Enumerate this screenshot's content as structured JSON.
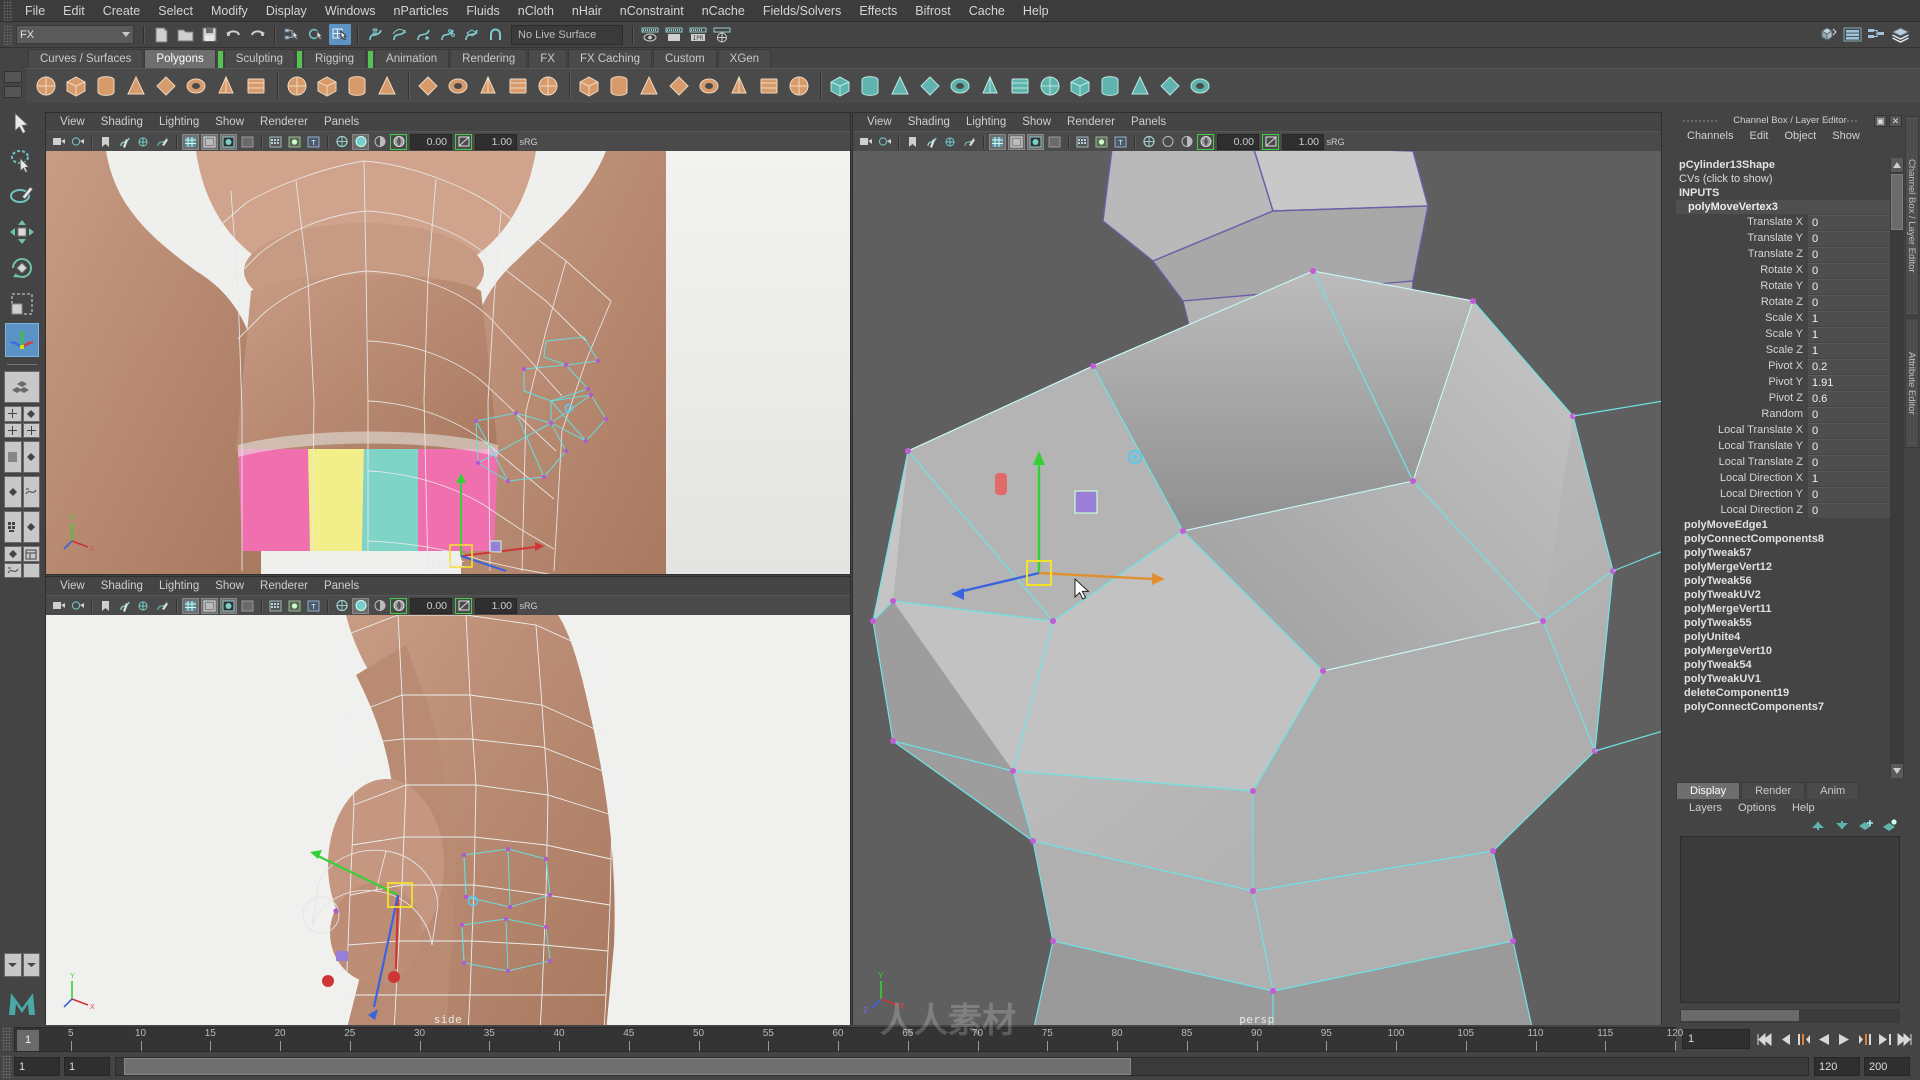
{
  "app": {
    "title": "Autodesk Maya"
  },
  "menubar": {
    "items": [
      "File",
      "Edit",
      "Create",
      "Select",
      "Modify",
      "Display",
      "Windows",
      "nParticles",
      "Fluids",
      "nCloth",
      "nHair",
      "nConstraint",
      "nCache",
      "Fields/Solvers",
      "Effects",
      "Bifrost",
      "Cache",
      "Help"
    ]
  },
  "statusline": {
    "menuset": "FX",
    "live_surface": "No Live Surface",
    "numeric_a": "0.00",
    "numeric_b": "1.00",
    "colorspace": "sRG",
    "icons": [
      "new-scene-icon",
      "open-scene-icon",
      "save-scene-icon",
      "undo-icon",
      "redo-icon",
      "select-by-hierarchy-icon",
      "select-by-object-icon",
      "select-by-component-icon",
      "snap-to-grid-icon",
      "snap-to-curve-icon",
      "snap-to-point-icon",
      "snap-to-projected-center-icon",
      "snap-to-view-plane-icon",
      "make-live-icon",
      "render-current-frame-icon",
      "ipr-render-icon",
      "render-settings-icon",
      "open-hypershade-icon",
      "open-outliner-icon",
      "open-node-editor-icon",
      "toggle-layers-icon"
    ]
  },
  "shelf": {
    "tabs": [
      {
        "label": "Curves / Surfaces",
        "active": false
      },
      {
        "label": "Polygons",
        "active": true
      },
      {
        "label": "Sculpting",
        "active": false
      },
      {
        "label": "Rigging",
        "active": false
      },
      {
        "label": "Animation",
        "active": false
      },
      {
        "label": "Rendering",
        "active": false
      },
      {
        "label": "FX",
        "active": false
      },
      {
        "label": "FX Caching",
        "active": false
      },
      {
        "label": "Custom",
        "active": false
      },
      {
        "label": "XGen",
        "active": false
      }
    ],
    "buttons": [
      "poly-sphere-icon",
      "poly-cube-icon",
      "poly-cylinder-icon",
      "poly-cone-icon",
      "poly-torus-icon",
      "poly-plane-icon",
      "poly-pyramid-icon",
      "poly-prism-icon",
      "poly-pipe-icon",
      "poly-helix-icon",
      "poly-soccer-ball-icon",
      "poly-platonic-icon",
      "combine-icon",
      "separate-icon",
      "booleans-icon",
      "smooth-icon",
      "mirror-icon",
      "reduce-icon",
      "multicut-icon",
      "extrude-icon",
      "bevel-icon",
      "bridge-icon",
      "append-polygon-icon",
      "wedge-icon",
      "target-weld-icon",
      "quad-draw-icon",
      "connect-icon",
      "crease-icon",
      "insert-edge-loop-icon",
      "offset-edge-loop-icon",
      "slide-edge-icon",
      "sculpt-icon",
      "uv-editor-icon",
      "uv-planar-icon",
      "uv-cylindrical-icon",
      "uv-automatic-icon",
      "uv-unfold-icon",
      "uv-layout-icon"
    ]
  },
  "toolbox": {
    "tools": [
      {
        "name": "select-tool",
        "selected": false
      },
      {
        "name": "lasso-select-tool",
        "selected": false
      },
      {
        "name": "paint-select-tool",
        "selected": false
      },
      {
        "name": "move-tool",
        "selected": false
      },
      {
        "name": "rotate-tool",
        "selected": false
      },
      {
        "name": "scale-tool",
        "selected": false
      },
      {
        "name": "last-tool-used",
        "selected": true
      }
    ],
    "layouts": [
      "single-perspective-layout",
      "four-view-layout",
      "two-panes-side-layout",
      "outliner-persp-layout",
      "persp-graph-layout",
      "hypershade-persp-layout",
      "outliner-persp-graph-layout"
    ]
  },
  "viewports": [
    {
      "id": "front",
      "label": "front",
      "menus": [
        "View",
        "Shading",
        "Lighting",
        "Show",
        "Renderer",
        "Panels"
      ],
      "numeric_a": "0.00",
      "numeric_b": "1.00",
      "colorspace": "sRG"
    },
    {
      "id": "side",
      "label": "side",
      "menus": [
        "View",
        "Shading",
        "Lighting",
        "Show",
        "Renderer",
        "Panels"
      ],
      "numeric_a": "0.00",
      "numeric_b": "1.00",
      "colorspace": "sRG"
    },
    {
      "id": "persp",
      "label": "persp",
      "menus": [
        "View",
        "Shading",
        "Lighting",
        "Show",
        "Renderer",
        "Panels"
      ],
      "numeric_a": "0.00",
      "numeric_b": "1.00",
      "colorspace": "sRG"
    }
  ],
  "channel_box": {
    "panel_title": "Channel Box / Layer Editor",
    "menus": [
      "Channels",
      "Edit",
      "Object",
      "Show"
    ],
    "shape_name": "pCylinder13Shape",
    "cvs_row": "CVs (click to show)",
    "inputs_header": "INPUTS",
    "input_node": "polyMoveVertex3",
    "attributes": [
      {
        "label": "Translate X",
        "value": "0"
      },
      {
        "label": "Translate Y",
        "value": "0"
      },
      {
        "label": "Translate Z",
        "value": "0"
      },
      {
        "label": "Rotate X",
        "value": "0"
      },
      {
        "label": "Rotate Y",
        "value": "0"
      },
      {
        "label": "Rotate Z",
        "value": "0"
      },
      {
        "label": "Scale X",
        "value": "1"
      },
      {
        "label": "Scale Y",
        "value": "1"
      },
      {
        "label": "Scale Z",
        "value": "1"
      },
      {
        "label": "Pivot X",
        "value": "0.2"
      },
      {
        "label": "Pivot Y",
        "value": "1.91"
      },
      {
        "label": "Pivot Z",
        "value": "0.6"
      },
      {
        "label": "Random",
        "value": "0"
      },
      {
        "label": "Local Translate X",
        "value": "0"
      },
      {
        "label": "Local Translate Y",
        "value": "0"
      },
      {
        "label": "Local Translate Z",
        "value": "0"
      },
      {
        "label": "Local Direction X",
        "value": "1"
      },
      {
        "label": "Local Direction Y",
        "value": "0"
      },
      {
        "label": "Local Direction Z",
        "value": "0"
      }
    ],
    "history_nodes": [
      "polyMoveEdge1",
      "polyConnectComponents8",
      "polyTweak57",
      "polyMergeVert12",
      "polyTweak56",
      "polyTweakUV2",
      "polyMergeVert11",
      "polyTweak55",
      "polyUnite4",
      "polyMergeVert10",
      "polyTweak54",
      "polyTweakUV1",
      "deleteComponent19",
      "polyConnectComponents7"
    ]
  },
  "layer_editor": {
    "tabs": [
      {
        "label": "Display",
        "active": true
      },
      {
        "label": "Render",
        "active": false
      },
      {
        "label": "Anim",
        "active": false
      }
    ],
    "menus": [
      "Layers",
      "Options",
      "Help"
    ],
    "icons": [
      "layer-move-up-icon",
      "layer-move-down-icon",
      "create-new-layer-icon",
      "create-layer-from-selected-icon"
    ]
  },
  "right_tabs": [
    {
      "label": "Channel Box / Layer Editor"
    },
    {
      "label": "Attribute Editor"
    }
  ],
  "time_slider": {
    "current_frame": "1",
    "start_tick": 1,
    "end_tick": 120,
    "tick_labels": [
      "5",
      "10",
      "15",
      "20",
      "25",
      "30",
      "35",
      "40",
      "45",
      "50",
      "55",
      "60",
      "65",
      "70",
      "75",
      "80",
      "85",
      "90",
      "95",
      "100",
      "105",
      "110",
      "115",
      "120"
    ],
    "playback_field": "1",
    "playback_buttons": [
      "go-to-start-icon",
      "step-back-frame-icon",
      "step-back-key-icon",
      "play-backwards-icon",
      "play-forwards-icon",
      "step-forward-key-icon",
      "step-forward-frame-icon",
      "go-to-end-icon"
    ]
  },
  "range_slider": {
    "anim_start": "1",
    "range_start": "1",
    "range_end": "120",
    "anim_end": "200"
  },
  "colors": {
    "bg": "#444444",
    "panel": "#3b3b3b",
    "viewport": "#5d5d5d",
    "accent_blue": "#5b94c4",
    "accent_green": "#54c354",
    "wire_cyan": "#6ee3e3",
    "wire_white": "#ffffff",
    "axis_x": "#d03030",
    "axis_y": "#30c030",
    "axis_z": "#3060e0",
    "text": "#d0d0d0"
  },
  "watermark": "人人素材"
}
